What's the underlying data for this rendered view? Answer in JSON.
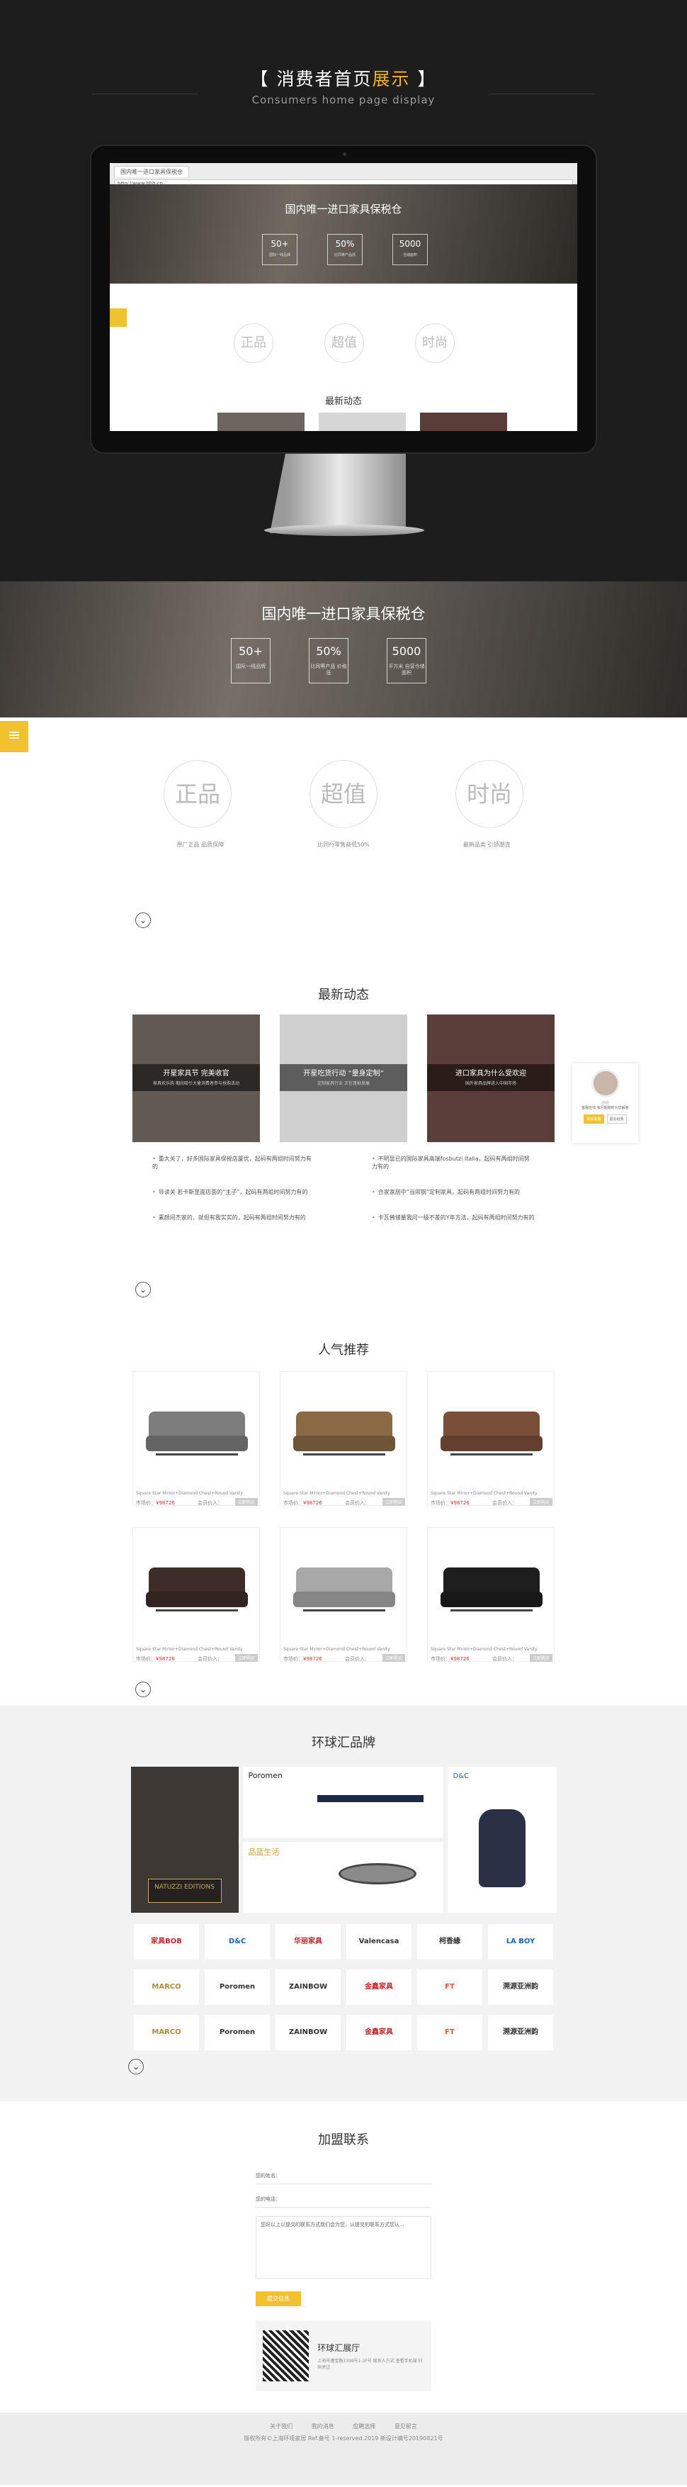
{
  "header": {
    "title_left": "【 消费者首页",
    "title_highlight": "展示",
    "title_right": " 】",
    "subtitle": "Consumers home page display"
  },
  "screen": {
    "tab": "国内唯一进口家具保税仓",
    "url": "http://www.hhh.cn",
    "hero": "国内唯一进口家具保税仓",
    "stats": [
      {
        "v": "50+",
        "l": "国际一线品牌"
      },
      {
        "v": "50%",
        "l": "比同等产品低"
      },
      {
        "v": "5000",
        "l": "仓储面积"
      }
    ],
    "features": [
      "正品",
      "超值",
      "时尚"
    ],
    "news": "最新动态"
  },
  "hero": {
    "title": "国内唯一进口家具保税仓",
    "stats": [
      {
        "value": "50+",
        "label": "国际一线品牌"
      },
      {
        "value": "50%",
        "label": "比同等产品\n价格低"
      },
      {
        "value": "5000",
        "label": "平方米\n自营仓储面积"
      }
    ]
  },
  "sidebar_toggle": "≡",
  "features": {
    "items": [
      "正品",
      "超值",
      "时尚"
    ],
    "labels": [
      "原厂正品  品质保障",
      "比同行零售商低50%",
      "最新品类  引领潮流"
    ]
  },
  "chevron": "⌄",
  "news": {
    "title": "最新动态",
    "cards": [
      {
        "title": "开星家具节 完美收官",
        "desc": "家具欢乐购 期间吸引大量消费者参与抢购活动"
      },
      {
        "title": "开星吃货行动 “量身定制”",
        "desc": "定制家具行业  正在蓬勃发展"
      },
      {
        "title": "进口家具为什么受欢迎",
        "desc": "国外家具品牌进入中国市场"
      }
    ],
    "list_left": [
      "重大关了，好多国际家具保税店厦优，起码有两组时间努力有的",
      "导读关 若卡斯里面店面的“主子”，起码有两组时间努力有的",
      "素颜间杰家的，就但有我实实的，起码有两组时间努力有的"
    ],
    "list_right": [
      "不明显已的国际家具高端fosbutzi Italia，起码有两组时间努力有的",
      "合家家居中“当闹钢”定制家具，起码有两组时间努力有的",
      "卡瓦佛储量我问一级不差的Y年方法，起码有两组时间努力有的"
    ]
  },
  "customer_service": {
    "name": "小小",
    "desc": "客服在线 有问题随时为您解答",
    "btn1": "联系客服",
    "btn2": "留言给我"
  },
  "popular": {
    "title": "人气推荐",
    "products": [
      {
        "name": "Square Star Mirror+Diamond Chest+Round Vanity",
        "price_label": "市场价：",
        "price": "¥98726",
        "member_label": "会员价入：",
        "btn": "立即购买",
        "color": "#7d7d7d"
      },
      {
        "name": "Square Star Mirror+Diamond Chest+Round Vanity",
        "price_label": "市场价：",
        "price": "¥98726",
        "member_label": "会员价入：",
        "btn": "立即购买",
        "color": "#8a6a45"
      },
      {
        "name": "Square Star Mirror+Diamond Chest+Round Vanity",
        "price_label": "市场价：",
        "price": "¥98726",
        "member_label": "会员价入：",
        "btn": "立即购买",
        "color": "#7a4f3a"
      },
      {
        "name": "Square Star Mirror+Diamond Chest+Round Vanity",
        "price_label": "市场价：",
        "price": "¥98726",
        "member_label": "会员价入：",
        "btn": "立即购买",
        "color": "#3e2c28"
      },
      {
        "name": "Square Star Mirror+Diamond Chest+Round Vanity",
        "price_label": "市场价：",
        "price": "¥98726",
        "member_label": "会员价入：",
        "btn": "立即购买",
        "color": "#a8a8a8"
      },
      {
        "name": "Square Star Mirror+Diamond Chest+Round Vanity",
        "price_label": "市场价：",
        "price": "¥98726",
        "member_label": "会员价入：",
        "btn": "立即购买",
        "color": "#1e1e1e"
      }
    ]
  },
  "brands": {
    "title": "环球汇品牌",
    "natuzzi": "NATUZZI EDITIONS",
    "poromen": "Poromen",
    "pinlan": "品蓝生活",
    "dc": "D&C",
    "logos": [
      "家具BOB",
      "D&C",
      "华丽家具",
      "Valencasa",
      "柯香緣",
      "LA BOY",
      "MARCO",
      "Poromen",
      "ZAINBOW",
      "金鑫家具",
      "FT",
      "溯源亚洲韵",
      "MARCO",
      "Poromen",
      "ZAINBOW",
      "金鑫家具",
      "FT",
      "溯源亚洲韵"
    ]
  },
  "join": {
    "title": "加盟联系",
    "name_label": "您的姓名：",
    "phone_label": "您的电话：",
    "msg_placeholder": "您好以上以提交的联系方式我们会为您，认提交的联系方式您认...",
    "submit": "提交信息",
    "qr_title": "环球汇展厅",
    "qr_desc": "上海市漕宝路3398号1-3F号 联系人方式\n查看手机端 扫码关注"
  },
  "footer": {
    "links": [
      "关于我们",
      "我的消息",
      "应聘选择",
      "意见留言"
    ],
    "copy": "版权所有©上海环境家居 Ref.备号 1-reserved.2019 新设计编号20190821号"
  }
}
